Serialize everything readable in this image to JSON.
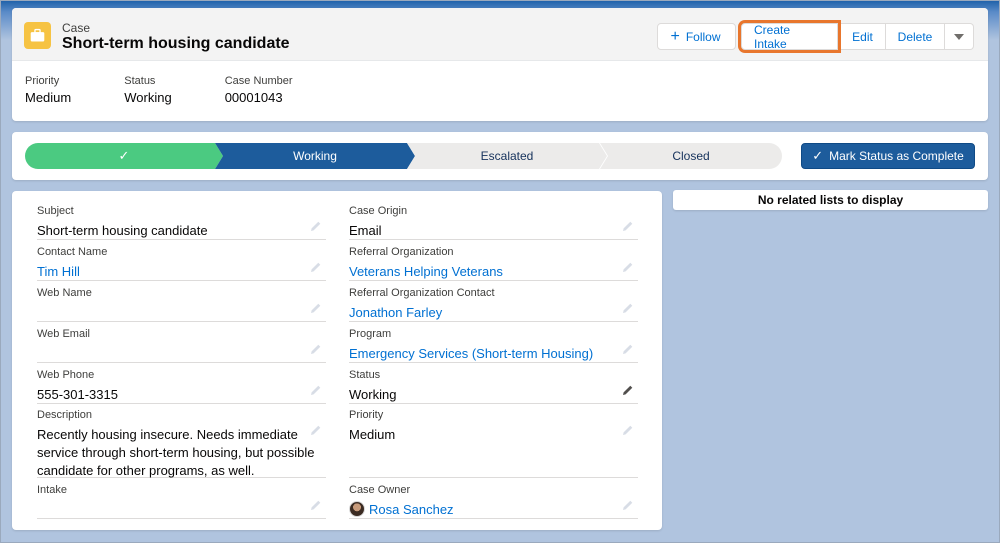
{
  "header": {
    "object_label": "Case",
    "title": "Short-term housing candidate",
    "actions": {
      "follow": "Follow",
      "create_intake": "Create Intake",
      "edit": "Edit",
      "delete": "Delete"
    },
    "highlights": [
      {
        "label": "Priority",
        "value": "Medium"
      },
      {
        "label": "Status",
        "value": "Working"
      },
      {
        "label": "Case Number",
        "value": "00001043"
      }
    ]
  },
  "path": {
    "stages": [
      "Working",
      "Escalated",
      "Closed"
    ],
    "current_stage": "Working",
    "mark_complete_label": "Mark Status as Complete"
  },
  "details": {
    "left": [
      {
        "label": "Subject",
        "value": "Short-term housing candidate"
      },
      {
        "label": "Contact Name",
        "value": "Tim Hill"
      },
      {
        "label": "Web Name",
        "value": ""
      },
      {
        "label": "Web Email",
        "value": ""
      },
      {
        "label": "Web Phone",
        "value": "555-301-3315"
      },
      {
        "label": "Description",
        "value": "Recently housing insecure. Needs immediate service through short-term housing, but possible candidate for other programs, as well."
      },
      {
        "label": "Intake",
        "value": ""
      }
    ],
    "right": [
      {
        "label": "Case Origin",
        "value": "Email"
      },
      {
        "label": "Referral Organization",
        "value": "Veterans Helping Veterans"
      },
      {
        "label": "Referral Organization Contact",
        "value": "Jonathon Farley"
      },
      {
        "label": "Program",
        "value": "Emergency Services (Short-term Housing)"
      },
      {
        "label": "Status",
        "value": "Working"
      },
      {
        "label": "Priority",
        "value": "Medium"
      },
      {
        "label": "Case Owner",
        "value": "Rosa Sanchez"
      }
    ]
  },
  "related": {
    "empty_message": "No related lists to display"
  },
  "colors": {
    "brand_blue": "#1d5c9c",
    "path_complete": "#4bca81",
    "link": "#0070d2",
    "highlight_outline": "#e8762d",
    "case_icon": "#f6c343"
  }
}
